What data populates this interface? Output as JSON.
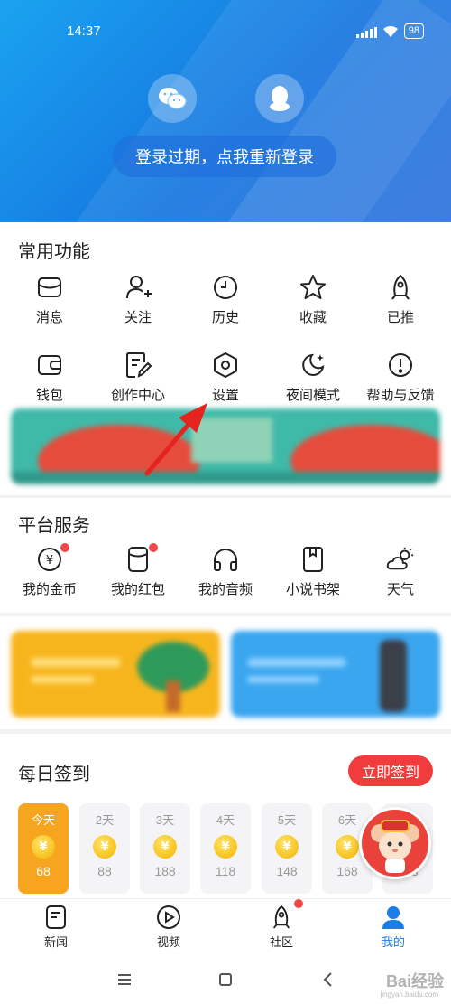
{
  "status_bar": {
    "time": "14:37",
    "battery": "98"
  },
  "header": {
    "login_options": [
      {
        "icon": "wechat-icon"
      },
      {
        "icon": "qq-penguin-icon"
      }
    ],
    "relogin_label": "登录过期，点我重新登录"
  },
  "common_functions": {
    "title": "常用功能",
    "items": [
      {
        "label": "消息",
        "icon": "message-icon"
      },
      {
        "label": "关注",
        "icon": "follow-user-icon"
      },
      {
        "label": "历史",
        "icon": "history-clock-icon"
      },
      {
        "label": "收藏",
        "icon": "star-icon"
      },
      {
        "label": "已推",
        "icon": "rocket-icon"
      },
      {
        "label": "钱包",
        "icon": "wallet-icon"
      },
      {
        "label": "创作中心",
        "icon": "edit-note-icon"
      },
      {
        "label": "设置",
        "icon": "settings-hex-icon"
      },
      {
        "label": "夜间模式",
        "icon": "moon-icon"
      },
      {
        "label": "帮助与反馈",
        "icon": "help-alert-icon"
      }
    ]
  },
  "platform_services": {
    "title": "平台服务",
    "items": [
      {
        "label": "我的金币",
        "icon": "gold-coin-icon",
        "badge": true
      },
      {
        "label": "我的红包",
        "icon": "red-packet-icon",
        "badge": true
      },
      {
        "label": "我的音频",
        "icon": "headphones-icon",
        "badge": false
      },
      {
        "label": "小说书架",
        "icon": "bookshelf-icon",
        "badge": false
      },
      {
        "label": "天气",
        "icon": "weather-cloud-sun-icon",
        "badge": false
      }
    ]
  },
  "daily_signin": {
    "title": "每日签到",
    "button_label": "立即签到",
    "days": [
      {
        "label": "今天",
        "value": "68",
        "today": true
      },
      {
        "label": "2天",
        "value": "88",
        "today": false
      },
      {
        "label": "3天",
        "value": "188",
        "today": false
      },
      {
        "label": "4天",
        "value": "118",
        "today": false
      },
      {
        "label": "5天",
        "value": "148",
        "today": false
      },
      {
        "label": "6天",
        "value": "168",
        "today": false
      },
      {
        "label": "7天",
        "value": "888",
        "today": false
      }
    ],
    "coin_symbol": "¥"
  },
  "tabbar": {
    "tabs": [
      {
        "label": "新闻",
        "icon": "news-icon",
        "active": false,
        "badge": false
      },
      {
        "label": "视频",
        "icon": "play-circle-icon",
        "active": false,
        "badge": false
      },
      {
        "label": "社区",
        "icon": "rocket-icon",
        "active": false,
        "badge": true
      },
      {
        "label": "我的",
        "icon": "user-profile-icon",
        "active": true,
        "badge": false
      }
    ]
  },
  "watermark": {
    "brand": "Bai经验",
    "url": "jingyan.baidu.com"
  },
  "colors": {
    "accent": "#1a7ee8",
    "signin_red": "#f03c3c",
    "badge_red": "#f04848",
    "today_orange": "#f7a51e"
  }
}
